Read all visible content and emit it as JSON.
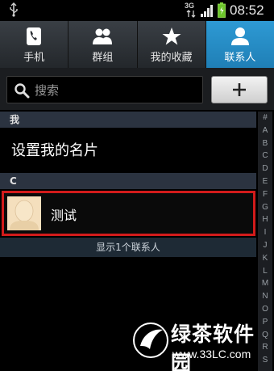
{
  "status_bar": {
    "network": "3G",
    "time": "08:52",
    "icons": [
      "usb-icon",
      "wifi-icon",
      "signal-icon",
      "battery-icon"
    ]
  },
  "tabs": [
    {
      "label": "手机",
      "icon": "phone-icon",
      "active": false
    },
    {
      "label": "群组",
      "icon": "group-icon",
      "active": false
    },
    {
      "label": "我的收藏",
      "icon": "star-icon",
      "active": false
    },
    {
      "label": "联系人",
      "icon": "person-icon",
      "active": true
    }
  ],
  "search": {
    "placeholder": "搜索",
    "value": ""
  },
  "add_button": {
    "icon": "plus-icon"
  },
  "sections": [
    {
      "header": "我",
      "items": [
        {
          "label": "设置我的名片"
        }
      ]
    },
    {
      "header": "C",
      "items": [
        {
          "label": "测试",
          "avatar": "avatar-icon",
          "highlighted": true
        }
      ]
    }
  ],
  "summary": "显示1个联系人",
  "index_letters": [
    "#",
    "A",
    "B",
    "C",
    "D",
    "E",
    "F",
    "G",
    "H",
    "I",
    "J",
    "K",
    "L",
    "M",
    "N",
    "O",
    "P",
    "Q",
    "R",
    "S"
  ],
  "watermark": {
    "name": "绿茶软件园",
    "url": "www.33LC.com"
  },
  "colors": {
    "active_tab": "#2e9ad4",
    "highlight_border": "#d21b1b",
    "section_header": "#2b3340"
  }
}
